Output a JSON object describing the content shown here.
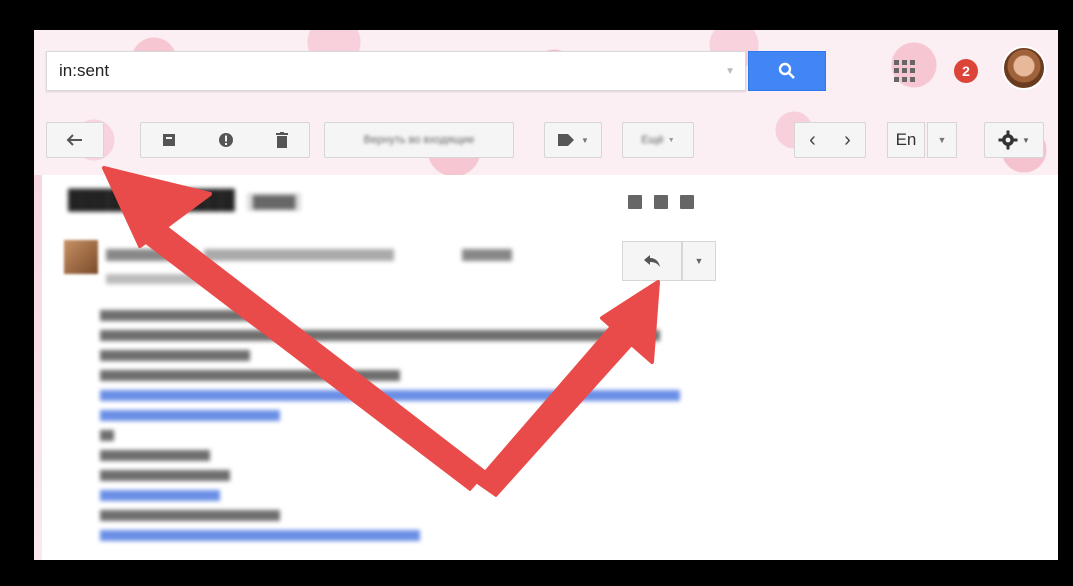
{
  "search": {
    "value": "in:sent",
    "placeholder": ""
  },
  "notifications": {
    "count": "2"
  },
  "toolbar": {
    "move_inbox_label": "Вернуть во входящие",
    "more_label": "Ещё",
    "language_label": "En"
  },
  "colors": {
    "accent_blue": "#4285f4",
    "badge_red": "#db4437",
    "arrow_red": "#e94a4a"
  },
  "icons": [
    "back-arrow-icon",
    "archive-icon",
    "spam-icon",
    "delete-icon",
    "label-icon",
    "search-icon",
    "apps-grid-icon",
    "chevron-left-icon",
    "chevron-right-icon",
    "gear-icon",
    "print-icon",
    "reply-icon",
    "chevron-down-icon"
  ]
}
